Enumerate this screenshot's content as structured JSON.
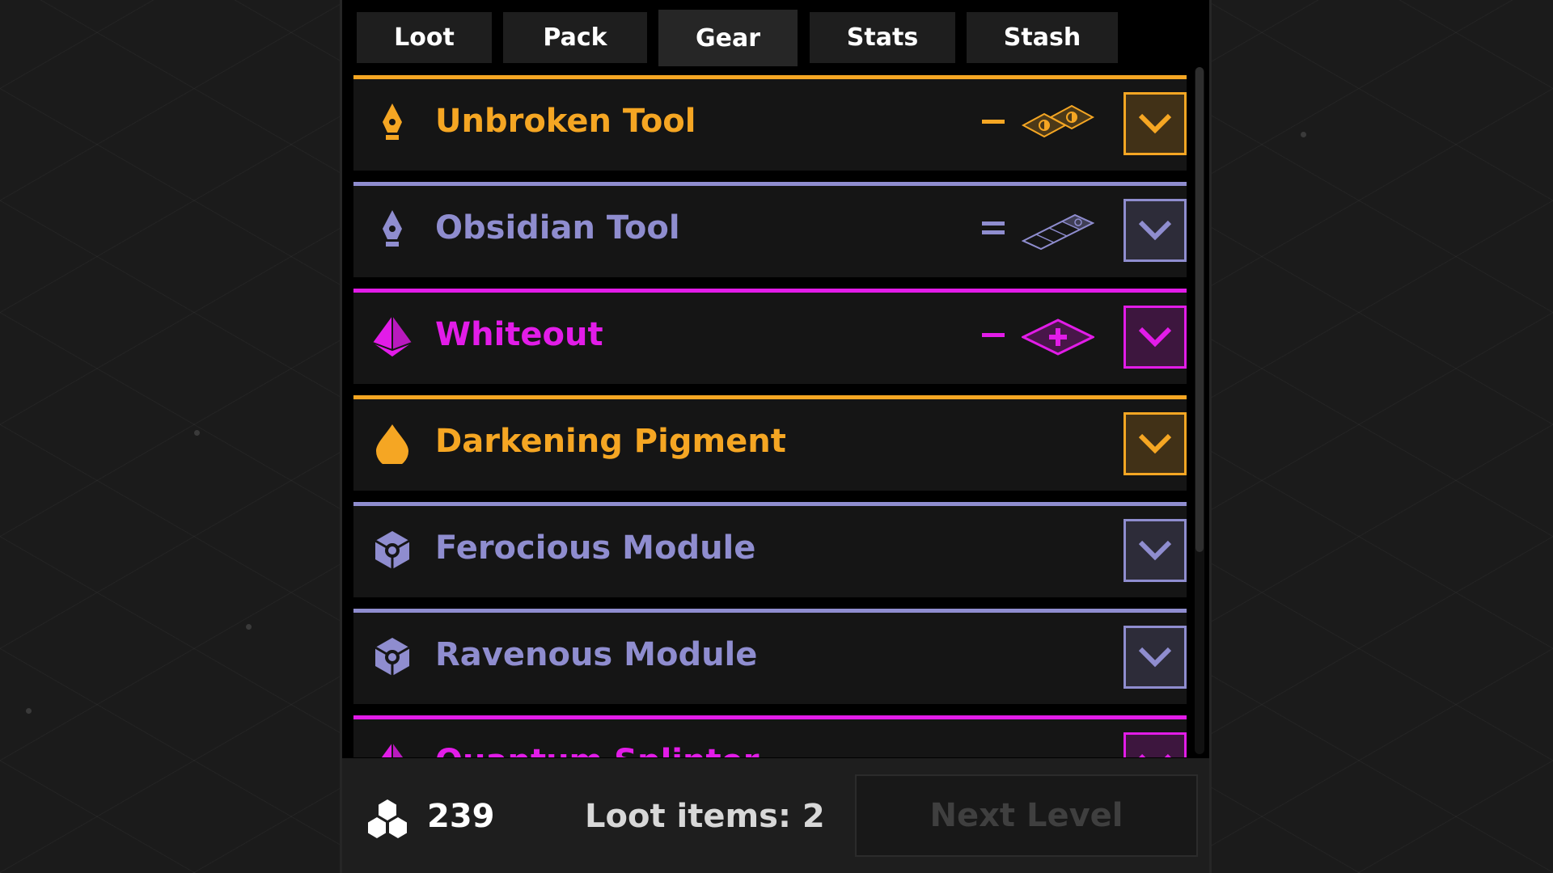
{
  "tabs": [
    "Loot",
    "Pack",
    "Gear",
    "Stats",
    "Stash"
  ],
  "active_tab": "Gear",
  "colors": {
    "legendary": "#f5a623",
    "rare": "#8f8dcf",
    "epic": "#e21ce8",
    "background": "#000000",
    "row": "#151515"
  },
  "items": [
    {
      "name": "Unbroken Tool",
      "icon": "pen-nib-icon",
      "rarity": "legendary",
      "indicator": "minus",
      "badge": "two-eye-tiles-icon"
    },
    {
      "name": "Obsidian Tool",
      "icon": "pen-nib-icon",
      "rarity": "rare",
      "indicator": "equals",
      "badge": "four-tile-strip-icon"
    },
    {
      "name": "Whiteout",
      "icon": "pyramid-icon",
      "rarity": "epic",
      "indicator": "minus",
      "badge": "plus-tile-icon"
    },
    {
      "name": "Darkening Pigment",
      "icon": "drop-icon",
      "rarity": "legendary",
      "indicator": "",
      "badge": ""
    },
    {
      "name": "Ferocious Module",
      "icon": "cube-module-icon",
      "rarity": "rare",
      "indicator": "",
      "badge": ""
    },
    {
      "name": "Ravenous Module",
      "icon": "cube-module-icon",
      "rarity": "rare",
      "indicator": "",
      "badge": ""
    },
    {
      "name": "Quantum Splinter",
      "icon": "pyramid-icon",
      "rarity": "epic",
      "indicator": "",
      "badge": ""
    }
  ],
  "footer": {
    "gems_icon": "hex-cluster-icon",
    "gems": "239",
    "loot_items": "Loot items: 2",
    "next_level": "Next Level"
  }
}
